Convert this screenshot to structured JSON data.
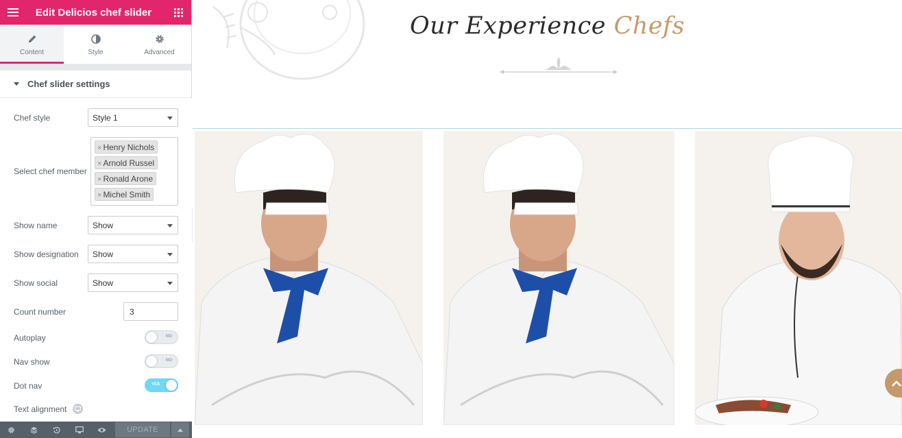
{
  "header": {
    "title": "Edit Delicios chef slider"
  },
  "tabs": [
    {
      "label": "Content",
      "icon": "pencil-icon",
      "active": true
    },
    {
      "label": "Style",
      "icon": "contrast-icon",
      "active": false
    },
    {
      "label": "Advanced",
      "icon": "gear-icon",
      "active": false
    }
  ],
  "section": {
    "title": "Chef slider settings"
  },
  "controls": {
    "chef_style": {
      "label": "Chef style",
      "value": "Style 1"
    },
    "select_chef": {
      "label": "Select chef member",
      "tags": [
        "Henry Nichols",
        "Arnold Russel",
        "Ronald Arone",
        "Michel Smith"
      ]
    },
    "show_name": {
      "label": "Show name",
      "value": "Show"
    },
    "show_designation": {
      "label": "Show designation",
      "value": "Show"
    },
    "show_social": {
      "label": "Show social",
      "value": "Show"
    },
    "count_number": {
      "label": "Count number",
      "value": "3"
    },
    "autoplay": {
      "label": "Autoplay",
      "state": "NO"
    },
    "nav_show": {
      "label": "Nav show",
      "state": "NO"
    },
    "dot_nav": {
      "label": "Dot nav",
      "state": "YES"
    },
    "text_alignment": {
      "label": "Text alignment",
      "icon": "desktop-icon"
    }
  },
  "footer": {
    "icons": [
      "gear-icon",
      "layers-icon",
      "history-icon",
      "responsive-icon",
      "eye-icon"
    ],
    "update_label": "UPDATE"
  },
  "preview": {
    "title_main": "Our Experience ",
    "title_accent": "Chefs",
    "accent_color": "#c49a6c",
    "brand_color": "#e2266b"
  }
}
